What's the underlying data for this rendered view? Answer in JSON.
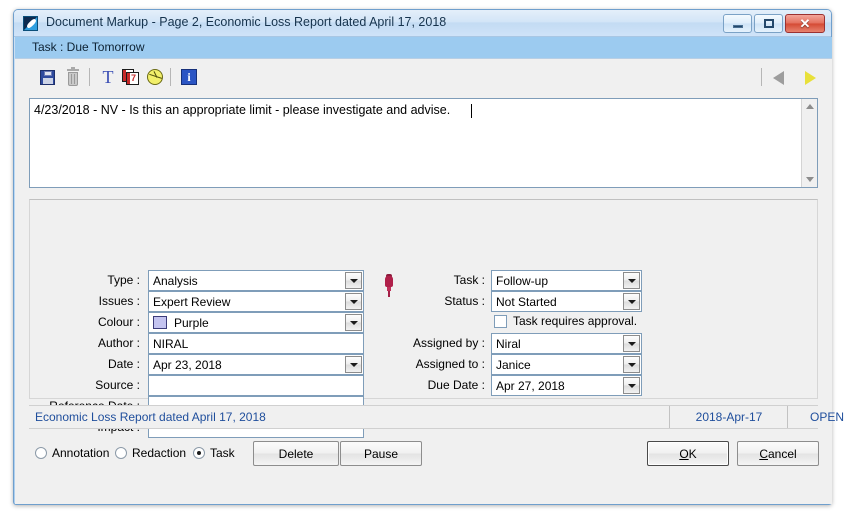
{
  "window": {
    "title": "Document Markup - Page 2, Economic Loss Report dated April 17, 2018",
    "subheader": "Task : Due Tomorrow",
    "icon": "document-markup-icon",
    "controls": {
      "minimize": "minimize-icon",
      "maximize": "maximize-icon",
      "close": "✕"
    }
  },
  "toolbar": {
    "items": [
      {
        "name": "save-icon",
        "tooltip": "Save",
        "enabled": true
      },
      {
        "name": "delete-icon",
        "tooltip": "Delete",
        "enabled": false
      },
      {
        "name": "text-icon",
        "tooltip": "Text",
        "glyph": "T",
        "enabled": true
      },
      {
        "name": "calendar-icon",
        "tooltip": "Date",
        "glyph": "7",
        "enabled": true
      },
      {
        "name": "pie-icon",
        "tooltip": "Chart",
        "enabled": true
      },
      {
        "name": "info-icon",
        "tooltip": "Information",
        "glyph": "i",
        "enabled": true
      }
    ],
    "nav": {
      "prev": "previous-arrow-icon",
      "next": "next-arrow-icon"
    }
  },
  "note": {
    "text": "4/23/2018 - NV - Is this an appropriate limit - please investigate and advise.",
    "scroll_up": "scroll-up-icon",
    "scroll_down": "scroll-down-icon"
  },
  "form": {
    "left": [
      {
        "label": "Type :",
        "value": "Analysis",
        "control": "combobox"
      },
      {
        "label": "Issues :",
        "value": "Expert Review",
        "control": "combobox"
      },
      {
        "label": "Colour :",
        "value": "Purple",
        "control": "combobox",
        "swatch": "#c3c3f0"
      },
      {
        "label": "Author :",
        "value": "NIRAL",
        "control": "textbox"
      },
      {
        "label": "Date :",
        "value": "Apr 23, 2018",
        "control": "combobox"
      },
      {
        "label": "Source :",
        "value": "",
        "control": "textbox"
      },
      {
        "label": "Reference Date :",
        "value": "",
        "control": "textbox"
      },
      {
        "label": "Impact :",
        "value": "",
        "control": "textbox"
      }
    ],
    "right": [
      {
        "label": "Task :",
        "value": "Follow-up",
        "control": "combobox"
      },
      {
        "label": "Status :",
        "value": "Not Started",
        "control": "combobox"
      },
      {
        "label": "Assigned by :",
        "value": "Niral",
        "control": "combobox"
      },
      {
        "label": "Assigned to :",
        "value": "Janice",
        "control": "combobox"
      },
      {
        "label": "Due Date :",
        "value": "Apr 27, 2018",
        "control": "combobox"
      }
    ],
    "approval_checkbox": {
      "label": "Task requires approval.",
      "checked": false
    },
    "pin_icon": "pin-icon"
  },
  "statusbar": {
    "document": "Economic Loss Report dated April 17, 2018",
    "date": "2018-Apr-17",
    "state": "OPEN",
    "text_color": "#1f4e9c"
  },
  "actions": {
    "radios": [
      {
        "label": "Annotation",
        "checked": false
      },
      {
        "label": "Redaction",
        "checked": false
      },
      {
        "label": "Task",
        "checked": true
      }
    ],
    "buttons": [
      {
        "label": "Delete",
        "name": "delete-button",
        "default": false
      },
      {
        "label": "Pause",
        "name": "pause-button",
        "default": false
      }
    ],
    "ok": {
      "accel": "O",
      "rest": "K",
      "label": "OK"
    },
    "cancel": {
      "accel": "C",
      "rest": "ancel",
      "label": "Cancel"
    }
  }
}
